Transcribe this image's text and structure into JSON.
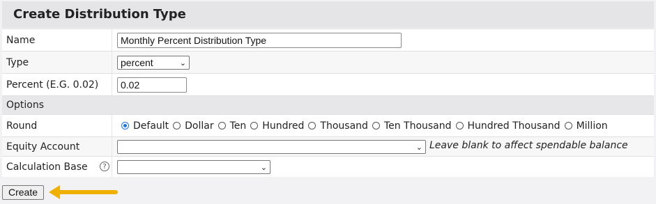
{
  "form": {
    "title": "Create Distribution Type",
    "name_label": "Name",
    "name_value": "Monthly Percent Distribution Type",
    "type_label": "Type",
    "type_value": "percent",
    "percent_label": "Percent (E.G. 0.02)",
    "percent_value": "0.02",
    "options_label": "Options",
    "round_label": "Round",
    "round_options": [
      "Default",
      "Dollar",
      "Ten",
      "Hundred",
      "Thousand",
      "Ten Thousand",
      "Hundred Thousand",
      "Million"
    ],
    "round_selected": "Default",
    "equity_label": "Equity Account",
    "equity_value": "",
    "equity_hint": "Leave blank to affect spendable balance",
    "calc_label": "Calculation Base",
    "calc_help": "?",
    "calc_value": "",
    "create_button": "Create"
  },
  "colors": {
    "accent": "#1a73e8",
    "arrow": "#f0b000"
  }
}
